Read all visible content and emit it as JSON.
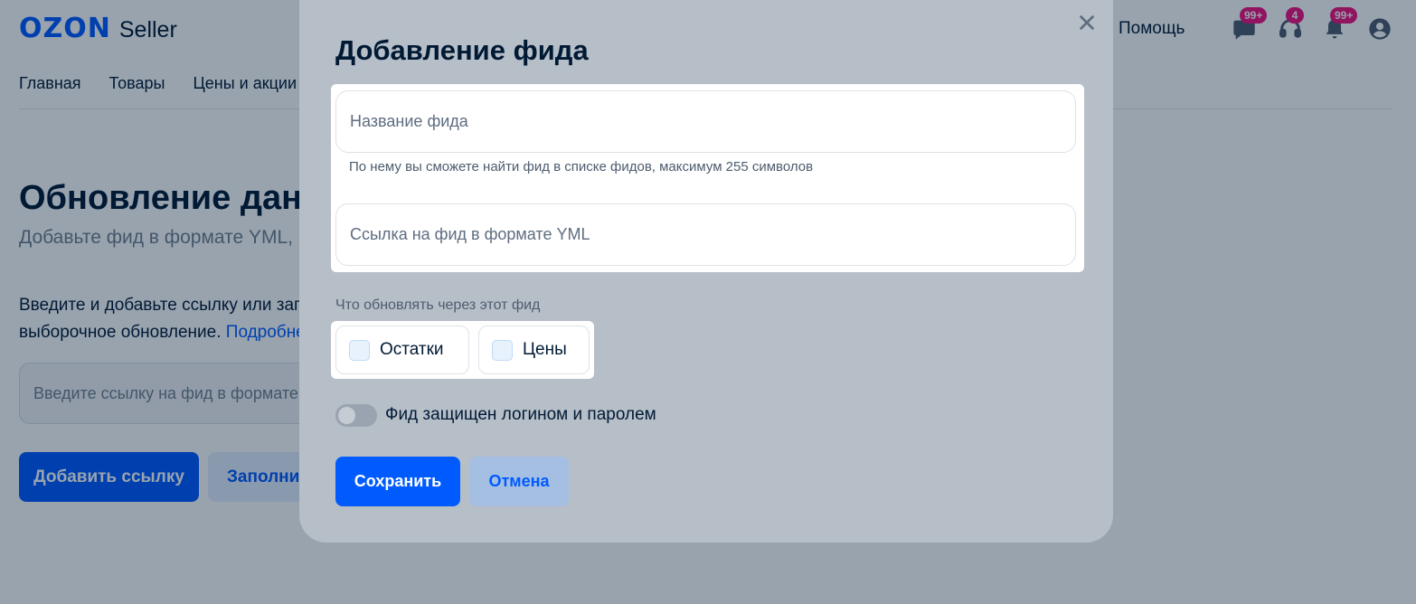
{
  "header": {
    "logo_brand": "OZON",
    "logo_product": "Seller",
    "help_label": "Помощь",
    "icons": [
      {
        "name": "chat-icon",
        "badge": "99+"
      },
      {
        "name": "support-headset-icon",
        "badge": "4"
      },
      {
        "name": "notifications-bell-icon",
        "badge": "99+"
      },
      {
        "name": "profile-avatar-icon"
      }
    ]
  },
  "nav": {
    "items": [
      "Главная",
      "Товары",
      "Цены и акции"
    ]
  },
  "background_page": {
    "title": "Обновление данных",
    "subtitle": "Добавьте фид в формате YML,",
    "description_line1": "Введите и добавьте ссылку или загрузите",
    "description_line2": "выборочное обновление. ",
    "more_link": "Подробнее",
    "feed_input_placeholder": "Введите ссылку на фид в формате YML",
    "add_link_button": "Добавить ссылку",
    "fill_button": "Заполнить"
  },
  "modal": {
    "title": "Добавление фида",
    "close_icon": "close-icon",
    "feed_name_placeholder": "Название фида",
    "feed_name_hint": "По нему вы сможете найти фид в списке фидов, максимум 255 символов",
    "feed_url_placeholder": "Ссылка на фид в формате YML",
    "update_section_label": "Что обновлять через этот фид",
    "checkbox_stock_label": "Остатки",
    "checkbox_prices_label": "Цены",
    "toggle_label": "Фид защищен логином и паролем",
    "toggle_state": "off",
    "save_button": "Сохранить",
    "cancel_button": "Отмена"
  },
  "colors": {
    "brand_blue": "#005bff",
    "badge_pink": "#f1117e",
    "text_dark": "#001a34"
  }
}
